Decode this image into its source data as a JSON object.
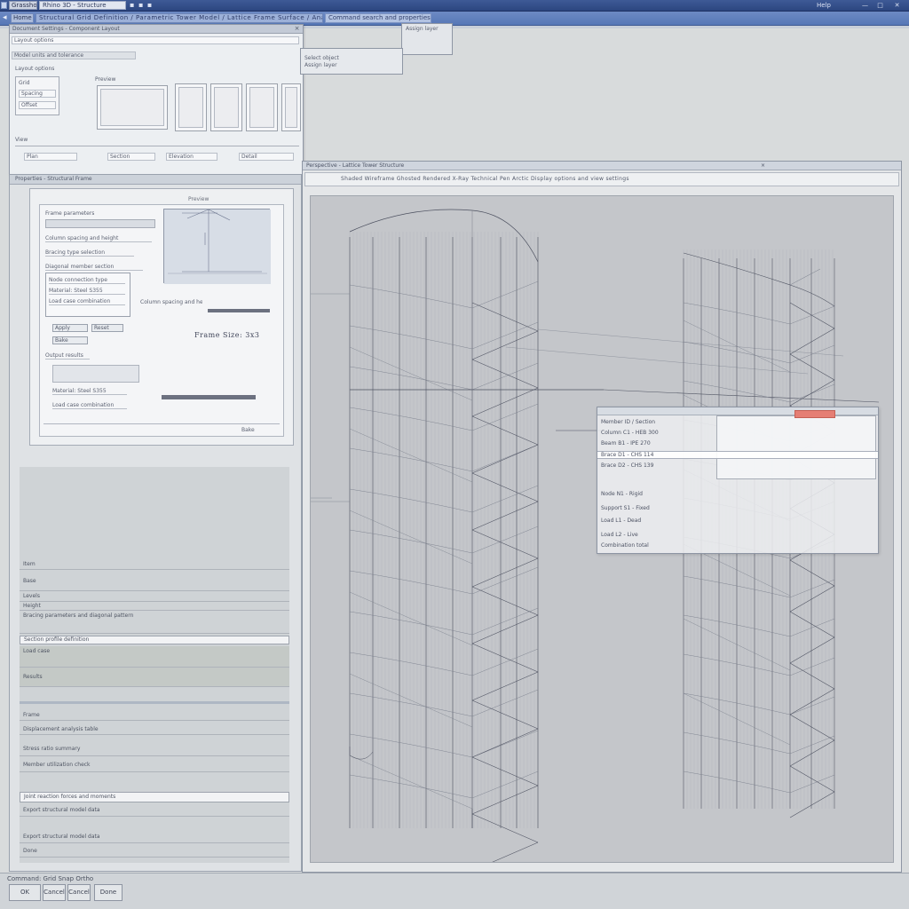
{
  "titlebar": {
    "doc_title": "Grasshopper",
    "app_title": "Rhino 3D - Structure",
    "quick_tools": "▪ ▪ ▪",
    "workspace_label": "Help",
    "min_label": "—",
    "max_label": "□",
    "close_label": "✕"
  },
  "ribbon": {
    "back_label": "◂",
    "home_label": "Home",
    "path_text": "Structural Grid Definition / Parametric Tower Model / Lattice Frame Surface / Analysis",
    "search_text": "Command search and properties"
  },
  "settings_dialog": {
    "header": "Document Settings - Component Layout",
    "close_label": "×",
    "row1": "Layout options",
    "row2": "Model units and tolerance",
    "group_label": "Preview",
    "fields": [
      "Grid",
      "Spacing",
      "Offset"
    ],
    "thumb_captions": [
      "Plan",
      "Section",
      "Elevation",
      "Detail",
      "View"
    ]
  },
  "popover": {
    "label1": "Select object",
    "label2": "Assign layer"
  },
  "props_panel": {
    "header": "Properties - Structural Frame",
    "section_title": "Frame parameters",
    "preview_caption": "Preview",
    "value_text": "Frame Size: 3x3",
    "lines": [
      "Column spacing and height",
      "Bracing type selection",
      "Diagonal member section",
      "Node connection type",
      "Material: Steel S355",
      "Load case combination",
      "Output results"
    ],
    "buttons": [
      "Apply",
      "Reset",
      "Bake"
    ]
  },
  "param_list": {
    "rows": [
      "Item",
      "Base",
      "Levels",
      "Height",
      "Bracing parameters and diagonal pattern",
      "Section profile definition",
      "Load case",
      "Results",
      "Frame",
      "Displacement analysis table",
      "Stress ratio summary",
      "Member utilization check",
      "Joint reaction forces and moments",
      "Export structural model data",
      "Done"
    ]
  },
  "viewport": {
    "title": "Perspective - Lattice Tower Structure",
    "close_label": "×",
    "toolbar_text": "Shaded  Wireframe  Ghosted  Rendered  X-Ray  Technical  Pen  Arctic  Display options and view settings"
  },
  "table_dialog": {
    "lines": [
      "Member ID / Section",
      "Column C1 - HEB 300",
      "Beam B1 - IPE 270",
      "Brace D1 - CHS 114",
      "Brace D2 - CHS 139",
      "Node N1 - Rigid",
      "Support S1 - Fixed",
      "Load L1 - Dead",
      "Load L2 - Live",
      "Combination total"
    ]
  },
  "statusbar": {
    "status_text": "Command: Grid  Snap  Ortho",
    "buttons": [
      "OK",
      "Cancel",
      "Done"
    ]
  },
  "colors": {
    "titlebar": "#2c4680",
    "ribbon": "#5677b6",
    "canvas": "#c4c6ca",
    "highlight": "#e57e74"
  }
}
